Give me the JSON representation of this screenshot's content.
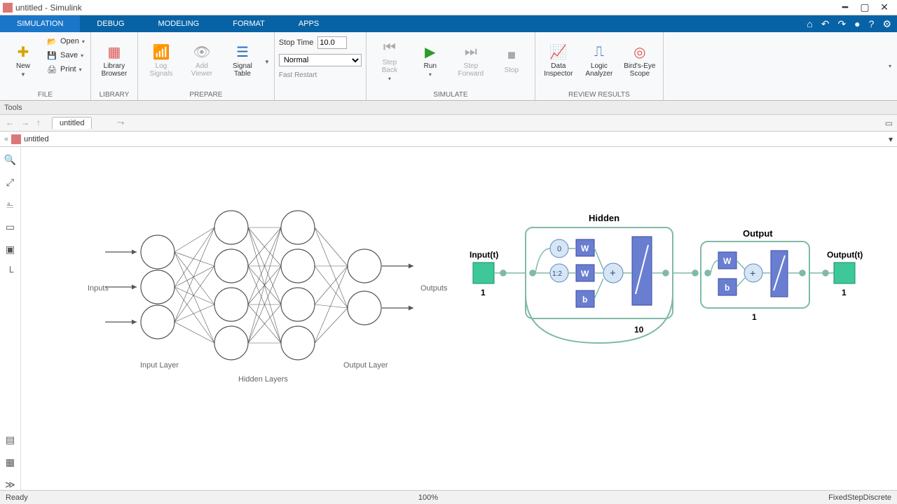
{
  "window": {
    "title": "untitled - Simulink"
  },
  "ribbon": {
    "tabs": [
      "SIMULATION",
      "DEBUG",
      "MODELING",
      "FORMAT",
      "APPS"
    ],
    "active": 0
  },
  "file": {
    "new": "New",
    "open": "Open",
    "save": "Save",
    "print": "Print",
    "group": "FILE"
  },
  "library": {
    "browser": "Library\nBrowser",
    "group": "LIBRARY"
  },
  "prepare": {
    "log": "Log\nSignals",
    "add": "Add\nViewer",
    "table": "Signal\nTable",
    "group": "PREPARE"
  },
  "simulate": {
    "stoptime_label": "Stop Time",
    "stoptime_value": "10.0",
    "mode": "Normal",
    "restart": "Fast Restart",
    "stepback": "Step\nBack",
    "run": "Run",
    "stepfwd": "Step\nForward",
    "stop": "Stop",
    "group": "SIMULATE"
  },
  "review": {
    "inspector": "Data\nInspector",
    "logic": "Logic\nAnalyzer",
    "scope": "Bird's-Eye\nScope",
    "group": "REVIEW RESULTS"
  },
  "toolsrow": "Tools",
  "tab": {
    "name": "untitled"
  },
  "breadcrumb": {
    "path": "untitled"
  },
  "status": {
    "ready": "Ready",
    "zoom": "100%",
    "solver": "FixedStepDiscrete"
  },
  "diagram": {
    "left": {
      "inputs_label": "Inputs",
      "input_layer": "Input Layer",
      "hidden_layers": "Hidden Layers",
      "output_layer": "Output Layer",
      "outputs_label": "Outputs"
    },
    "right": {
      "input_t": "Input(t)",
      "input_count": "1",
      "hidden_label": "Hidden",
      "hidden_count": "10",
      "delay0": "0",
      "delay12": "1:2",
      "W": "W",
      "b": "b",
      "output_label": "Output",
      "output_count": "1",
      "output_t": "Output(t)",
      "output_t_count": "1"
    }
  }
}
